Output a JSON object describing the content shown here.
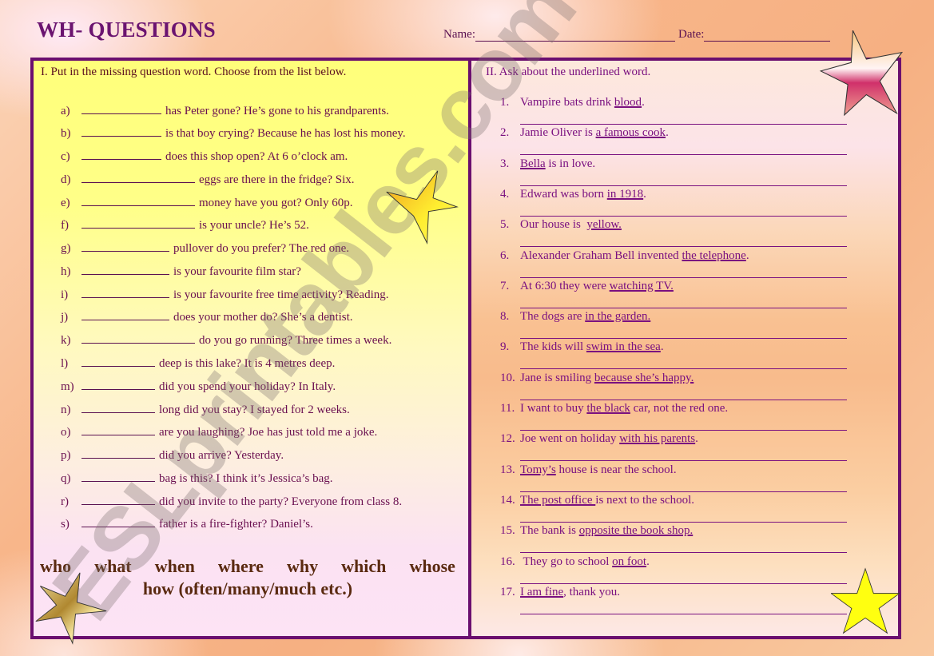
{
  "header": {
    "title": "WH- QUESTIONS",
    "name_label": "Name:",
    "date_label": "Date:"
  },
  "section1": {
    "instruction": "I. Put in the missing question word. Choose from the list below.",
    "items": [
      {
        "label": "a)",
        "text": "has Peter gone? He’s gone to his grandparents."
      },
      {
        "label": "b)",
        "text": "is that boy crying? Because he has lost his money."
      },
      {
        "label": "c)",
        "text": "does this shop open? At 6 o’clock am."
      },
      {
        "label": "d)",
        "text": "eggs are there in the fridge? Six."
      },
      {
        "label": "e)",
        "text": "money have you got? Only 60p."
      },
      {
        "label": "f)",
        "text": "is your uncle? He’s 52."
      },
      {
        "label": "g)",
        "text": "pullover do you prefer? The red one."
      },
      {
        "label": "h)",
        "text": "is your favourite film star?"
      },
      {
        "label": "i)",
        "text": "is your favourite free time activity? Reading."
      },
      {
        "label": "j)",
        "text": "does your mother do? She’s a dentist."
      },
      {
        "label": "k)",
        "text": "do you go running? Three times a week."
      },
      {
        "label": "l)",
        "text": "deep is this lake? It is 4 metres deep."
      },
      {
        "label": "m)",
        "text": "did you spend your holiday? In Italy."
      },
      {
        "label": "n)",
        "text": "long did you stay? I stayed for 2 weeks."
      },
      {
        "label": "o)",
        "text": "are you laughing? Joe has just told me a joke."
      },
      {
        "label": "p)",
        "text": "did you arrive? Yesterday."
      },
      {
        "label": "q)",
        "text": "bag is this? I think it’s Jessica’s bag."
      },
      {
        "label": "r)",
        "text": "did you invite to the party? Everyone from class 8."
      },
      {
        "label": "s)",
        "text": "father is a fire-fighter? Daniel’s."
      }
    ],
    "word_list": [
      "who",
      "what",
      "when",
      "where",
      "why",
      "which",
      "whose"
    ],
    "word_list_extra": "how (often/many/much etc.)"
  },
  "section2": {
    "instruction": "II.  Ask about the underlined word.",
    "items": [
      {
        "num": "1.",
        "before": "Vampire bats drink ",
        "underlined": "blood",
        "after": "."
      },
      {
        "num": "2.",
        "before": "Jamie Oliver is ",
        "underlined": "a famous cook",
        "after": "."
      },
      {
        "num": "3.",
        "before": "",
        "underlined": "Bella",
        "after": " is in love."
      },
      {
        "num": "4.",
        "before": "Edward was born ",
        "underlined": "in 1918",
        "after": "."
      },
      {
        "num": "5.",
        "before": "Our house is  ",
        "underlined": "yellow.",
        "after": ""
      },
      {
        "num": "6.",
        "before": "Alexander Graham Bell invented ",
        "underlined": "the telephone",
        "after": "."
      },
      {
        "num": "7.",
        "before": "At 6:30 they were ",
        "underlined": "watching TV.",
        "after": ""
      },
      {
        "num": "8.",
        "before": "The dogs are ",
        "underlined": "in the garden.",
        "after": ""
      },
      {
        "num": "9.",
        "before": "The kids will ",
        "underlined": "swim in the sea",
        "after": "."
      },
      {
        "num": "10.",
        "before": "Jane is smiling ",
        "underlined": "because she’s happy.",
        "after": ""
      },
      {
        "num": "11.",
        "before": "I want to buy ",
        "underlined": "the black",
        "after": " car, not the red one."
      },
      {
        "num": "12.",
        "before": "Joe went on holiday ",
        "underlined": "with his parents",
        "after": "."
      },
      {
        "num": "13.",
        "before": "",
        "underlined": "Tomy’s",
        "after": " house is near the school."
      },
      {
        "num": "14.",
        "before": "",
        "underlined": "The post office ",
        "after": "is next to the school."
      },
      {
        "num": "15.",
        "before": "The bank is ",
        "underlined": "opposite the book shop.",
        "after": ""
      },
      {
        "num": "16.",
        "before": " They go to school ",
        "underlined": "on foot",
        "after": "."
      },
      {
        "num": "17.",
        "before": "",
        "underlined": "I am fine",
        "after": ", thank you."
      }
    ]
  },
  "watermark": "ESLprintables.com",
  "colors": {
    "frame": "#6b0f6f",
    "title": "#6b1470",
    "text_left": "#6a0f50",
    "text_right": "#7a1080",
    "word_list": "#5a2a10"
  }
}
